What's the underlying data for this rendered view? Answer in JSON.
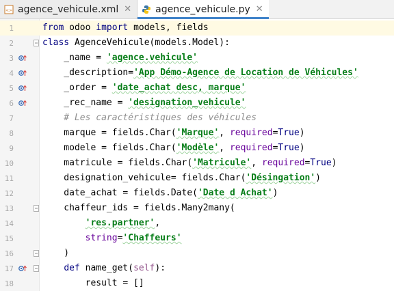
{
  "tabs": [
    {
      "label": "agence_vehicule.xml",
      "icon": "xml-file-icon",
      "active": false
    },
    {
      "label": "agence_vehicule.py",
      "icon": "python-file-icon",
      "active": true
    }
  ],
  "colors": {
    "keyword": "#000080",
    "string": "#067d17",
    "kwarg": "#660099",
    "comment": "#8c8c8c",
    "self": "#94558d"
  },
  "lines": [
    {
      "num": "1",
      "tokens": [
        [
          "kw",
          "from"
        ],
        [
          "",
          " odoo "
        ],
        [
          "kw",
          "import"
        ],
        [
          "",
          " models, fields"
        ]
      ]
    },
    {
      "num": "2",
      "tokens": [
        [
          "kw",
          "class"
        ],
        [
          "",
          " AgenceVehicule(models.Model):"
        ]
      ]
    },
    {
      "num": "3",
      "tokens": [
        [
          "",
          "    _name = "
        ],
        [
          "str",
          "'agence.vehicule'"
        ]
      ]
    },
    {
      "num": "4",
      "tokens": [
        [
          "",
          "    _description="
        ],
        [
          "str",
          "'App Démo-Agence de Location de Véhicules'"
        ]
      ]
    },
    {
      "num": "5",
      "tokens": [
        [
          "",
          "    _order = "
        ],
        [
          "str",
          "'date_achat desc, marque'"
        ]
      ]
    },
    {
      "num": "6",
      "tokens": [
        [
          "",
          "    _rec_name = "
        ],
        [
          "str",
          "'designation_vehicule'"
        ]
      ]
    },
    {
      "num": "7",
      "tokens": [
        [
          "cmt",
          "    # Les caractéristiques des véhicules"
        ]
      ]
    },
    {
      "num": "8",
      "tokens": [
        [
          "",
          "    marque = fields.Char("
        ],
        [
          "str",
          "'Marque'"
        ],
        [
          "",
          ", "
        ],
        [
          "kwa",
          "required"
        ],
        [
          "",
          "="
        ],
        [
          "kw",
          "True"
        ],
        [
          "",
          ")"
        ]
      ]
    },
    {
      "num": "9",
      "tokens": [
        [
          "",
          "    modele = fields.Char("
        ],
        [
          "str",
          "'Modèle'"
        ],
        [
          "",
          ", "
        ],
        [
          "kwa",
          "required"
        ],
        [
          "",
          "="
        ],
        [
          "kw",
          "True"
        ],
        [
          "",
          ")"
        ]
      ]
    },
    {
      "num": "10",
      "tokens": [
        [
          "",
          "    matricule = fields.Char("
        ],
        [
          "str",
          "'Matricule'"
        ],
        [
          "",
          ", "
        ],
        [
          "kwa",
          "required"
        ],
        [
          "",
          "="
        ],
        [
          "kw",
          "True"
        ],
        [
          "",
          ")"
        ]
      ]
    },
    {
      "num": "11",
      "tokens": [
        [
          "",
          "    designation_vehicule= fields.Char("
        ],
        [
          "str",
          "'Désingation'"
        ],
        [
          "",
          ")"
        ]
      ]
    },
    {
      "num": "12",
      "tokens": [
        [
          "",
          "    date_achat = fields.Date("
        ],
        [
          "str",
          "'Date d Achat'"
        ],
        [
          "",
          ")"
        ]
      ]
    },
    {
      "num": "13",
      "tokens": [
        [
          "",
          "    chaffeur_ids = fields.Many2many("
        ]
      ]
    },
    {
      "num": "14",
      "tokens": [
        [
          "",
          "        "
        ],
        [
          "str",
          "'res.partner'"
        ],
        [
          "",
          ","
        ]
      ]
    },
    {
      "num": "15",
      "tokens": [
        [
          "",
          "        "
        ],
        [
          "kwa",
          "string"
        ],
        [
          "",
          "="
        ],
        [
          "str",
          "'Chaffeurs'"
        ]
      ]
    },
    {
      "num": "16",
      "tokens": [
        [
          "",
          "    )"
        ]
      ]
    },
    {
      "num": "17",
      "tokens": [
        [
          "",
          "    "
        ],
        [
          "kw",
          "def"
        ],
        [
          "",
          " name_get("
        ],
        [
          "self",
          "self"
        ],
        [
          "",
          "):"
        ]
      ]
    },
    {
      "num": "18",
      "tokens": [
        [
          "",
          "        result = []"
        ]
      ]
    }
  ],
  "override_markers": [
    "3",
    "4",
    "5",
    "6",
    "17"
  ]
}
